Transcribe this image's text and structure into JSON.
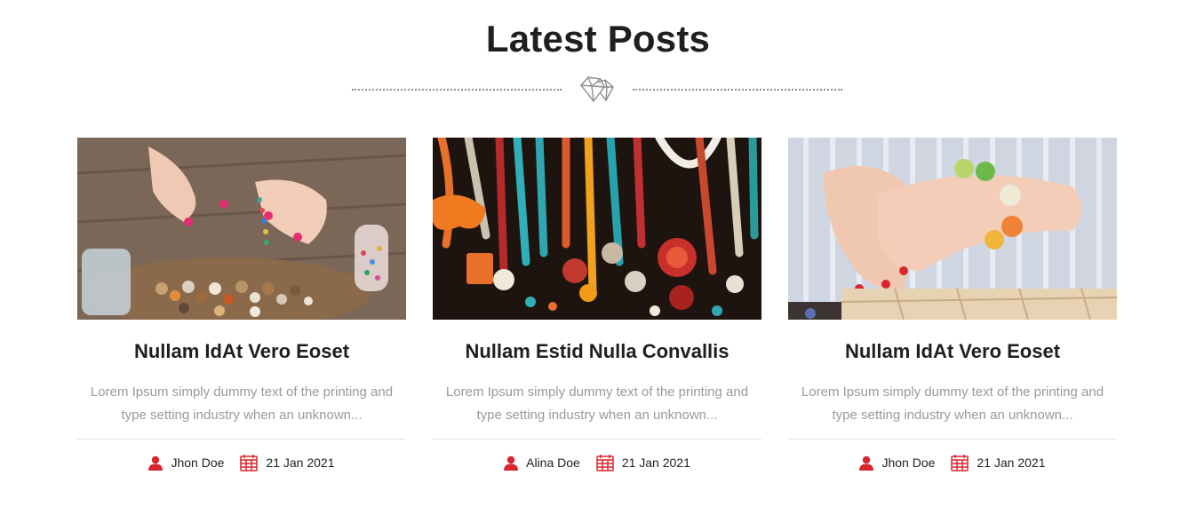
{
  "section": {
    "title": "Latest Posts",
    "divider_icon": "diamond-icon"
  },
  "colors": {
    "accent": "#d9262c",
    "title": "#1f1f1f",
    "excerpt": "#9a9a9a",
    "divider": "#8c8c8c"
  },
  "posts": [
    {
      "image": "beading-hands-photo",
      "title": "Nullam IdAt Vero Eoset",
      "excerpt_line1": "Lorem Ipsum simply dummy text of the printing and",
      "excerpt_line2": "type setting industry when an unknown...",
      "author_icon": "user-icon",
      "author": "Jhon Doe",
      "date_icon": "calendar-icon",
      "date": "21 Jan 2021"
    },
    {
      "image": "hanging-necklaces-photo",
      "title": "Nullam Estid Nulla Convallis",
      "excerpt_line1": "Lorem Ipsum simply dummy text of the printing and",
      "excerpt_line2": "type setting industry when an unknown...",
      "author_icon": "user-icon",
      "author": "Alina Doe",
      "date_icon": "calendar-icon",
      "date": "21 Jan 2021"
    },
    {
      "image": "bracelet-wrist-photo",
      "title": "Nullam IdAt Vero Eoset",
      "excerpt_line1": "Lorem Ipsum simply dummy text of the printing and",
      "excerpt_line2": "type setting industry when an unknown...",
      "author_icon": "user-icon",
      "author": "Jhon Doe",
      "date_icon": "calendar-icon",
      "date": "21 Jan 2021"
    }
  ]
}
